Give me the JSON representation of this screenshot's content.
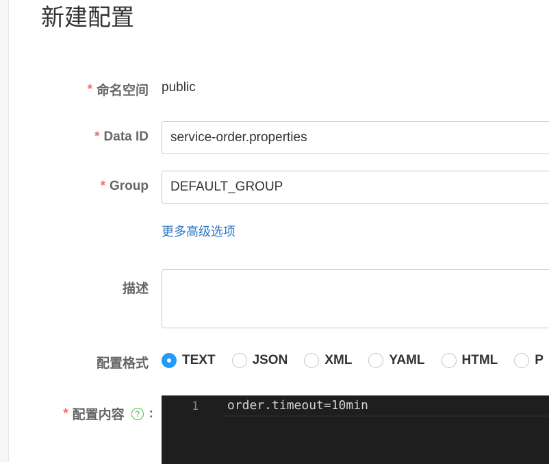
{
  "page": {
    "title": "新建配置"
  },
  "form": {
    "required_mark": "*",
    "namespace": {
      "label": "命名空间",
      "value": "public"
    },
    "data_id": {
      "label": "Data ID",
      "value": "service-order.properties"
    },
    "group": {
      "label": "Group",
      "value": "DEFAULT_GROUP"
    },
    "advanced_link": "更多高级选项",
    "description": {
      "label": "描述",
      "value": ""
    },
    "format": {
      "label": "配置格式",
      "options": [
        "TEXT",
        "JSON",
        "XML",
        "YAML",
        "HTML",
        "P"
      ],
      "selected": "TEXT"
    },
    "content": {
      "label": "配置内容",
      "help_icon_glyph": "?",
      "colon": ":",
      "lines": [
        {
          "number": "1",
          "text": "order.timeout=10min"
        }
      ]
    }
  },
  "colors": {
    "accent": "#209bfa",
    "required": "#f56c6c",
    "link": "#2b78c5",
    "editor_bg": "#1e1e1e"
  }
}
